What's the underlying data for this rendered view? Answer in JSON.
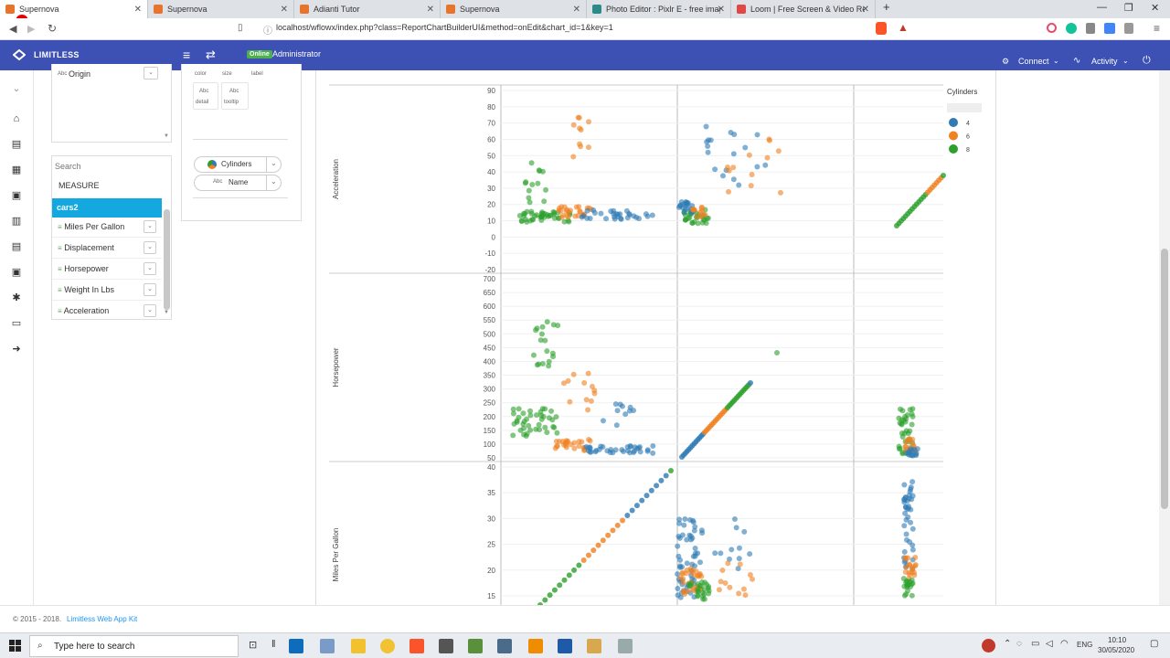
{
  "browser": {
    "tabs": [
      {
        "title": "Supernova",
        "active": true,
        "color": "#e8732c"
      },
      {
        "title": "Supernova",
        "active": false,
        "color": "#e8732c"
      },
      {
        "title": "Adianti Tutor",
        "active": false,
        "color": "#e8732c"
      },
      {
        "title": "Supernova",
        "active": false,
        "color": "#e8732c"
      },
      {
        "title": "Photo Editor : Pixlr E - free image",
        "active": false,
        "color": "#2a8a8a"
      },
      {
        "title": "Loom | Free Screen & Video Recor",
        "active": false,
        "color": "#e04848"
      }
    ],
    "new_tab": "+",
    "url": "localhost/wflowx/index.php?class=ReportChartBuilderUI&method=onEdit&chart_id=1&key=1"
  },
  "app": {
    "brand": "LIMITLESS",
    "status_badge": "Online",
    "user": "Administrator",
    "connect_label": "Connect",
    "activity_label": "Activity",
    "accent": "#3d51b5"
  },
  "left_panel": {
    "dimension_field": {
      "type": "Abc",
      "label": "Origin"
    },
    "search_placeholder": "Search",
    "measure_header": "MEASURE",
    "dataset": "cars2",
    "dataset_color": "#14a8e0",
    "measures": [
      "Miles Per Gallon",
      "Displacement",
      "Horsepower",
      "Weight In Lbs",
      "Acceleration"
    ]
  },
  "marks_panel": {
    "slots_top": [
      "color",
      "size",
      "label"
    ],
    "slots": [
      {
        "abc": "Abc",
        "name": "detail"
      },
      {
        "abc": "Abc",
        "name": "tooltip"
      }
    ],
    "pills": [
      {
        "label": "Cylinders",
        "prefix_icon": "palette-icon"
      },
      {
        "label": "Name",
        "prefix": "Abc"
      }
    ]
  },
  "chart_data": {
    "type": "scatter",
    "subtype": "scatter-matrix",
    "rows": [
      "Acceleration",
      "Horsepower",
      "Miles Per Gallon"
    ],
    "row_ticks": [
      [
        "90",
        "80",
        "70",
        "60",
        "50",
        "40",
        "30",
        "20",
        "10",
        "0",
        "-10",
        "-20"
      ],
      [
        "700",
        "650",
        "600",
        "550",
        "500",
        "450",
        "400",
        "350",
        "300",
        "250",
        "200",
        "150",
        "100",
        "50"
      ],
      [
        "40",
        "35",
        "30",
        "25",
        "20",
        "15"
      ]
    ],
    "legend": {
      "title": "Cylinders",
      "entries": [
        {
          "label": "4",
          "color": "#2e7bb6"
        },
        {
          "label": "6",
          "color": "#f08020"
        },
        {
          "label": "8",
          "color": "#2ca02c"
        }
      ]
    },
    "series_colors": {
      "4": "#2e7bb6",
      "6": "#f08020",
      "8": "#2ca02c"
    }
  },
  "footer": {
    "text": "© 2015 - 2018.",
    "link": "Limitless Web App Kit"
  },
  "taskbar": {
    "search_placeholder": "Type here to search",
    "lang": "ENG",
    "time": "10:10",
    "date": "30/05/2020"
  }
}
